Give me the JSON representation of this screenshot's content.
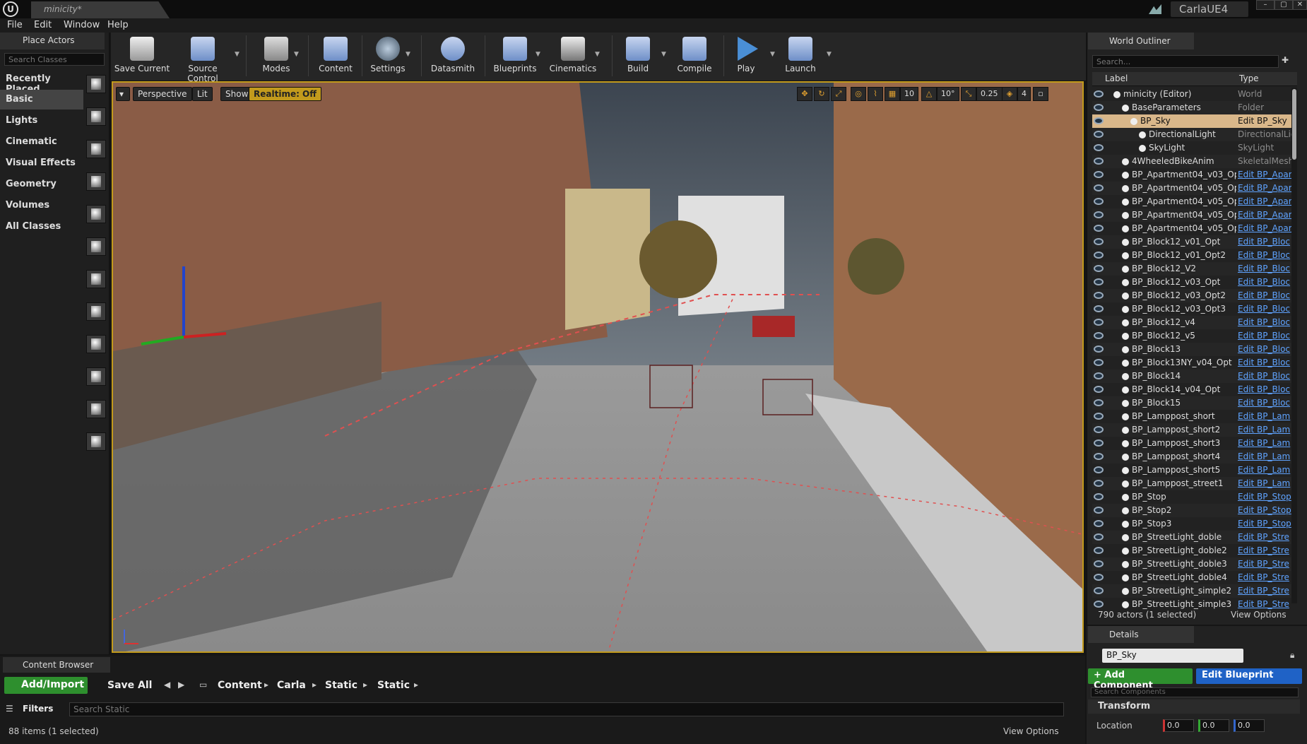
{
  "titlebar": {
    "tab": "minicity*",
    "project": "CarlaUE4",
    "min": "–",
    "max": "▢",
    "close": "✕"
  },
  "menu": [
    "File",
    "Edit",
    "Window",
    "Help"
  ],
  "place_actors": {
    "tab": "Place Actors",
    "search_placeholder": "Search Classes",
    "categories": [
      "Recently Placed",
      "Basic",
      "Lights",
      "Cinematic",
      "Visual Effects",
      "Geometry",
      "Volumes",
      "All Classes"
    ],
    "selected": "Basic"
  },
  "toolbar": {
    "buttons": [
      "Save Current",
      "Source Control",
      "Modes",
      "Content",
      "Settings",
      "Datasmith",
      "Blueprints",
      "Cinematics",
      "Build",
      "Compile",
      "Play",
      "Launch"
    ]
  },
  "viewport": {
    "perspective": "Perspective",
    "lit": "Lit",
    "show": "Show",
    "realtime": "Realtime: Off",
    "grid": "10",
    "rot": "10°",
    "scale": "0.25",
    "cam": "4"
  },
  "outliner": {
    "tab": "World Outliner",
    "search_placeholder": "Search...",
    "col_label": "Label",
    "col_type": "Type",
    "rows": [
      {
        "label": "minicity (Editor)",
        "type": "World",
        "indent": 0,
        "link": false
      },
      {
        "label": "BaseParameters",
        "type": "Folder",
        "indent": 1,
        "link": false
      },
      {
        "label": "BP_Sky",
        "type": "Edit BP_Sky",
        "indent": 2,
        "link": false,
        "selected": true
      },
      {
        "label": "DirectionalLight",
        "type": "DirectionalLig",
        "indent": 3,
        "link": false
      },
      {
        "label": "SkyLight",
        "type": "SkyLight",
        "indent": 3,
        "link": false
      },
      {
        "label": "4WheeledBikeAnim",
        "type": "SkeletalMeshA",
        "indent": 1,
        "link": false
      },
      {
        "label": "BP_Apartment04_v03_Op",
        "type": "Edit BP_Apar",
        "indent": 1,
        "link": true
      },
      {
        "label": "BP_Apartment04_v05_Op",
        "type": "Edit BP_Apar",
        "indent": 1,
        "link": true
      },
      {
        "label": "BP_Apartment04_v05_Op",
        "type": "Edit BP_Apar",
        "indent": 1,
        "link": true
      },
      {
        "label": "BP_Apartment04_v05_Op",
        "type": "Edit BP_Apar",
        "indent": 1,
        "link": true
      },
      {
        "label": "BP_Apartment04_v05_Op",
        "type": "Edit BP_Apar",
        "indent": 1,
        "link": true
      },
      {
        "label": "BP_Block12_v01_Opt",
        "type": "Edit BP_Bloc",
        "indent": 1,
        "link": true
      },
      {
        "label": "BP_Block12_v01_Opt2",
        "type": "Edit BP_Bloc",
        "indent": 1,
        "link": true
      },
      {
        "label": "BP_Block12_V2",
        "type": "Edit BP_Bloc",
        "indent": 1,
        "link": true
      },
      {
        "label": "BP_Block12_v03_Opt",
        "type": "Edit BP_Bloc",
        "indent": 1,
        "link": true
      },
      {
        "label": "BP_Block12_v03_Opt2",
        "type": "Edit BP_Bloc",
        "indent": 1,
        "link": true
      },
      {
        "label": "BP_Block12_v03_Opt3",
        "type": "Edit BP_Bloc",
        "indent": 1,
        "link": true
      },
      {
        "label": "BP_Block12_v4",
        "type": "Edit BP_Bloc",
        "indent": 1,
        "link": true
      },
      {
        "label": "BP_Block12_v5",
        "type": "Edit BP_Bloc",
        "indent": 1,
        "link": true
      },
      {
        "label": "BP_Block13",
        "type": "Edit BP_Bloc",
        "indent": 1,
        "link": true
      },
      {
        "label": "BP_Block13NY_v04_Opt",
        "type": "Edit BP_Bloc",
        "indent": 1,
        "link": true
      },
      {
        "label": "BP_Block14",
        "type": "Edit BP_Bloc",
        "indent": 1,
        "link": true
      },
      {
        "label": "BP_Block14_v04_Opt",
        "type": "Edit BP_Bloc",
        "indent": 1,
        "link": true
      },
      {
        "label": "BP_Block15",
        "type": "Edit BP_Bloc",
        "indent": 1,
        "link": true
      },
      {
        "label": "BP_Lamppost_short",
        "type": "Edit BP_Lam",
        "indent": 1,
        "link": true
      },
      {
        "label": "BP_Lamppost_short2",
        "type": "Edit BP_Lam",
        "indent": 1,
        "link": true
      },
      {
        "label": "BP_Lamppost_short3",
        "type": "Edit BP_Lam",
        "indent": 1,
        "link": true
      },
      {
        "label": "BP_Lamppost_short4",
        "type": "Edit BP_Lam",
        "indent": 1,
        "link": true
      },
      {
        "label": "BP_Lamppost_short5",
        "type": "Edit BP_Lam",
        "indent": 1,
        "link": true
      },
      {
        "label": "BP_Lamppost_street1",
        "type": "Edit BP_Lam",
        "indent": 1,
        "link": true
      },
      {
        "label": "BP_Stop",
        "type": "Edit BP_Stop",
        "indent": 1,
        "link": true
      },
      {
        "label": "BP_Stop2",
        "type": "Edit BP_Stop",
        "indent": 1,
        "link": true
      },
      {
        "label": "BP_Stop3",
        "type": "Edit BP_Stop",
        "indent": 1,
        "link": true
      },
      {
        "label": "BP_StreetLight_doble",
        "type": "Edit BP_Stre",
        "indent": 1,
        "link": true
      },
      {
        "label": "BP_StreetLight_doble2",
        "type": "Edit BP_Stre",
        "indent": 1,
        "link": true
      },
      {
        "label": "BP_StreetLight_doble3",
        "type": "Edit BP_Stre",
        "indent": 1,
        "link": true
      },
      {
        "label": "BP_StreetLight_doble4",
        "type": "Edit BP_Stre",
        "indent": 1,
        "link": true
      },
      {
        "label": "BP_StreetLight_simple2",
        "type": "Edit BP_Stre",
        "indent": 1,
        "link": true
      },
      {
        "label": "BP_StreetLight_simple3",
        "type": "Edit BP_Stre",
        "indent": 1,
        "link": true
      }
    ],
    "status": "790 actors (1 selected)",
    "view_options": "View Options"
  },
  "details": {
    "tab": "Details",
    "name": "BP_Sky",
    "add_component": "+ Add Component",
    "edit_blueprint": "Edit Blueprint",
    "search_placeholder": "Search Components",
    "transform": "Transform",
    "location_label": "Location",
    "location": [
      "0.0",
      "0.0",
      "0.0"
    ]
  },
  "content_browser": {
    "tab": "Content Browser",
    "add_import": "Add/Import",
    "save_all": "Save All",
    "path": [
      "Content",
      "Carla",
      "Static",
      "Static"
    ],
    "filters": "Filters",
    "search_placeholder": "Search Static",
    "status": "88 items (1 selected)",
    "view_options": "View Options"
  },
  "colors": {
    "accent": "#c29a1c",
    "green": "#2e8f2e",
    "blue": "#1f62c6",
    "link": "#5fa3ff",
    "selected_row": "#d9b78a"
  }
}
